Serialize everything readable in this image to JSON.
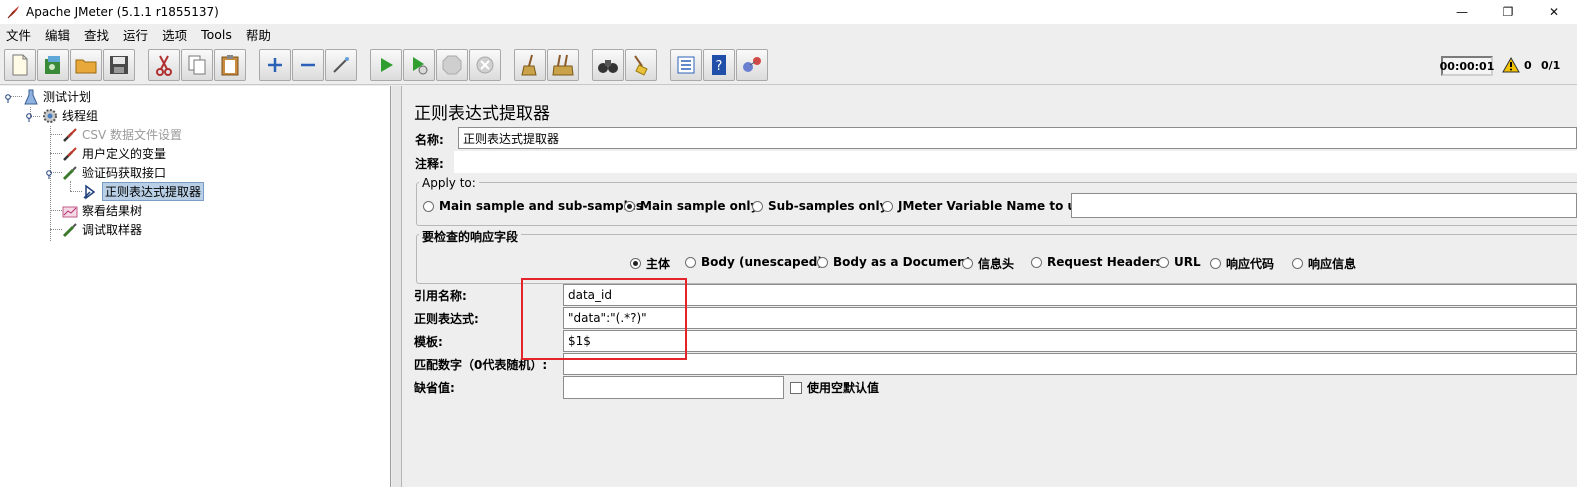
{
  "window": {
    "title": "Apache JMeter (5.1.1 r1855137)",
    "minimize": "—",
    "maximize": "❐",
    "close": "✕"
  },
  "menu": [
    "文件",
    "编辑",
    "查找",
    "运行",
    "选项",
    "Tools",
    "帮助"
  ],
  "toolbar": {
    "timer": "00:00:01",
    "warnings": "0",
    "threads": "0/1"
  },
  "tree": {
    "test_plan": "测试计划",
    "thread_group": "线程组",
    "csv_config": "CSV 数据文件设置",
    "user_vars": "用户定义的变量",
    "sampler": "验证码获取接口",
    "regex_extractor": "正则表达式提取器",
    "results_tree": "察看结果树",
    "debug_sampler": "调试取样器"
  },
  "panel": {
    "title": "正则表达式提取器",
    "name_label": "名称:",
    "name_value": "正则表达式提取器",
    "comment_label": "注释:",
    "comment_value": "",
    "apply_to": {
      "title": "Apply to:",
      "options": [
        "Main sample and sub-samples",
        "Main sample only",
        "Sub-samples only",
        "JMeter Variable Name to use"
      ],
      "selected": 1,
      "var_value": ""
    },
    "response_field": {
      "title": "要检查的响应字段",
      "options": [
        "主体",
        "Body (unescaped)",
        "Body as a Document",
        "信息头",
        "Request Headers",
        "URL",
        "响应代码",
        "响应信息"
      ],
      "selected": 0
    },
    "ref_name_label": "引用名称:",
    "ref_name_value": "data_id",
    "regex_label": "正则表达式:",
    "regex_value": "\"data\":\"(.*?)\"",
    "template_label": "模板:",
    "template_value": "$1$",
    "match_no_label": "匹配数字（0代表随机）:",
    "match_no_value": "",
    "default_label": "缺省值:",
    "default_value": "",
    "use_empty_label": "使用空默认值"
  },
  "colors": {
    "highlight_box": "#e3242b",
    "selection": "#b8cfe5"
  }
}
